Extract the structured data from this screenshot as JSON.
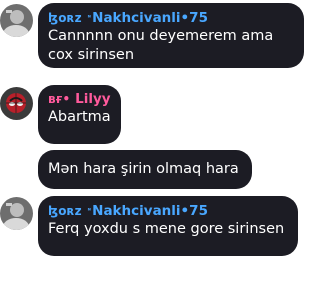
{
  "messages": [
    {
      "sender_tag": "ɮᴏʀz",
      "sender_mark": "ᶰ",
      "sender_name": "Nakhcivanli•75",
      "text": "Cannnnn onu deyemerem ama cox sirinsen"
    },
    {
      "sender_tag": "ʙғ•",
      "sender_name": "Lilyy",
      "text": "Abartma"
    },
    {
      "text": "Mən hara şirin olmaq hara"
    },
    {
      "sender_tag": "ɮᴏʀz",
      "sender_mark": "ᶰ",
      "sender_name": "Nakhcivanli•75",
      "text": "Ferq yoxdu s mene gore sirinsen"
    }
  ],
  "colors": {
    "bubble_bg": "#1c1c24",
    "sender_blue": "#49a7ff",
    "sender_pink": "#ff5a9c"
  }
}
